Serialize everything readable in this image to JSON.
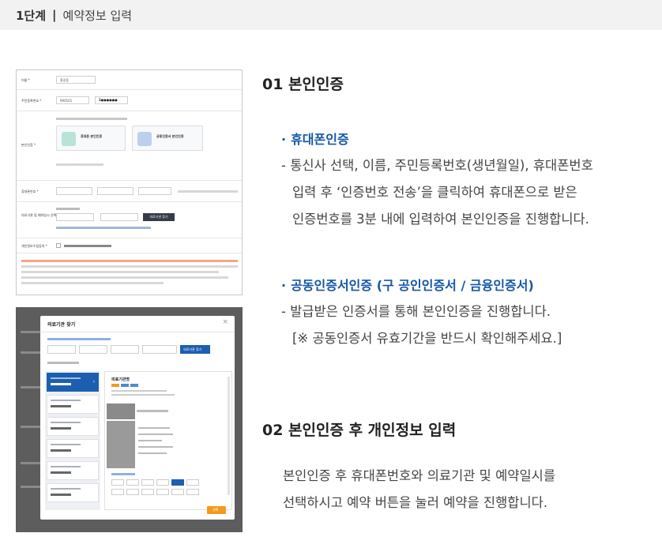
{
  "header": {
    "step": "1단계",
    "separator": "|",
    "title": "예약정보 입력"
  },
  "sections": {
    "s1": {
      "title": "01 본인인증",
      "phone": {
        "heading": "휴대폰인증",
        "line1": "- 통신사 선택, 이름, 주민등록번호(생년월일), 휴대폰번호",
        "line2": "입력 후 ‘인증번호 전송’을 클릭하여 휴대폰으로 받은",
        "line3": "인증번호를 3분 내에 입력하여 본인인증을 진행합니다."
      },
      "cert": {
        "heading": "공동인증서인증 (구 공인인증서 / 금융인증서)",
        "line1": "- 발급받은 인증서를 통해 본인인증을 진행합니다.",
        "line2": "[※ 공동인증서 유효기간을 반드시 확인해주세요.]"
      }
    },
    "s2": {
      "title": "02 본인인증 후 개인정보 입력",
      "line1": "본인인증 후 휴대폰번호와 의료기관 및 예약일시를",
      "line2": "선택하시고 예약 버튼을 눌러 예약을 진행합니다."
    }
  },
  "screenshot1": {
    "labels": [
      "이름 *",
      "주민등록번호 *",
      "본인인증 *",
      "휴대폰번호 *",
      "의료기관 및 예약일시 선택 *",
      "개인정보수집동의 *"
    ],
    "name_value": "홍길동",
    "rrn_front": "990101",
    "rrn_back": "1●●●●●●",
    "phone_card": "휴대폰 본인인증",
    "cert_card": "공동인증서 본인인증",
    "search_button": "의료기관 찾기"
  },
  "screenshot2": {
    "modal_title": "의료기관 찾기",
    "close": "×",
    "search_button": "의료기관 찾기",
    "list_items": [
      "의료기관명",
      "의료기관명",
      "의료기관명",
      "의료기관명",
      "의료기관명",
      "의료기관명"
    ],
    "detail_title": "의료기관명",
    "confirm": "선택"
  },
  "colors": {
    "accent_blue": "#1558a6",
    "warn_orange": "#f39a1e"
  }
}
